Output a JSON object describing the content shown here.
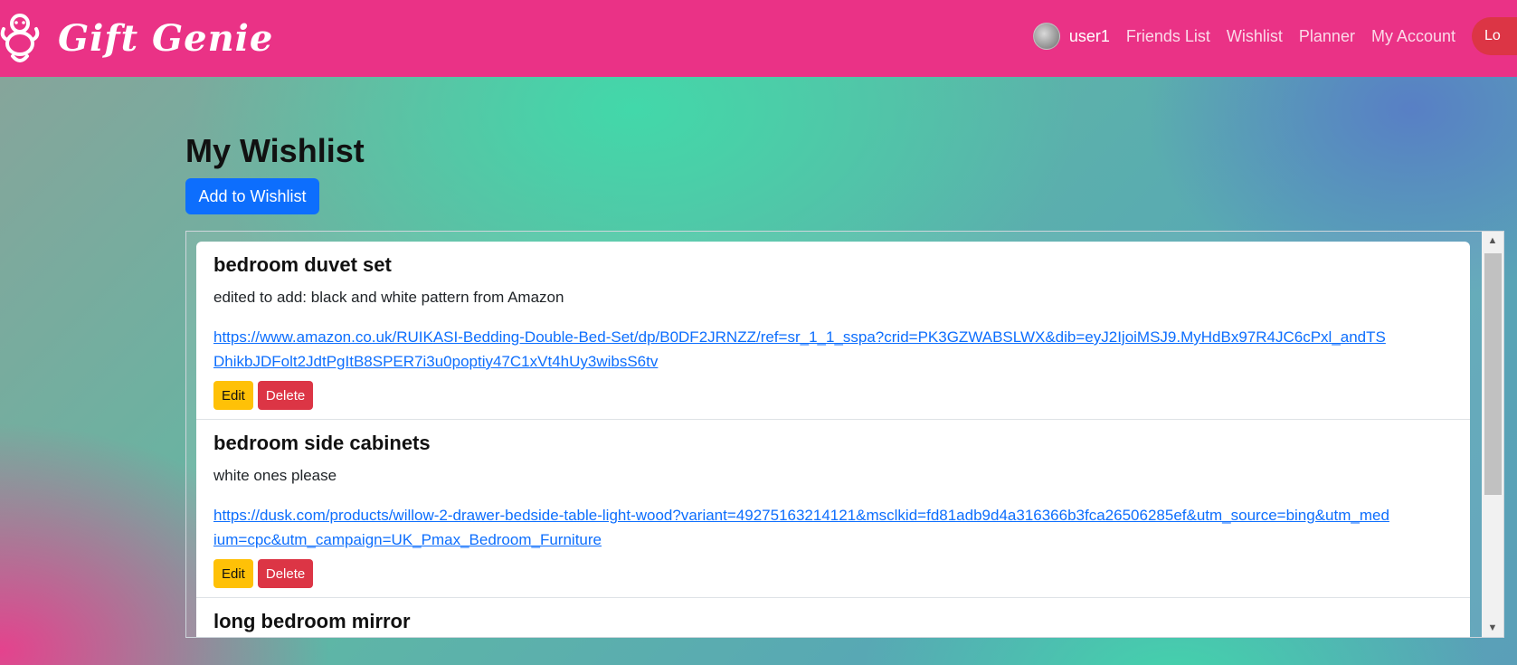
{
  "brand": {
    "name": "Gift Genie",
    "logo_icon": "genie-logo-icon"
  },
  "nav": {
    "username": "user1",
    "links": [
      "Friends List",
      "Wishlist",
      "Planner",
      "My Account"
    ],
    "logout_label": "Lo"
  },
  "main": {
    "title": "My Wishlist",
    "add_button": "Add to Wishlist"
  },
  "items": [
    {
      "title": "bedroom duvet set",
      "description": "edited to add: black and white pattern from Amazon",
      "link": "https://www.amazon.co.uk/RUIKASI-Bedding-Double-Bed-Set/dp/B0DF2JRNZZ/ref=sr_1_1_sspa?crid=PK3GZWABSLWX&dib=eyJ2IjoiMSJ9.MyHdBx97R4JC6cPxl_andTSDhikbJDFolt2JdtPgItB8SPER7i3u0poptiy47C1xVt4hUy3wibsS6tv",
      "edit_label": "Edit",
      "delete_label": "Delete"
    },
    {
      "title": "bedroom side cabinets",
      "description": "white ones please",
      "link": "https://dusk.com/products/willow-2-drawer-bedside-table-light-wood?variant=49275163214121&msclkid=fd81adb9d4a316366b3fca26506285ef&utm_source=bing&utm_medium=cpc&utm_campaign=UK_Pmax_Bedroom_Furniture",
      "edit_label": "Edit",
      "delete_label": "Delete"
    },
    {
      "title": "long bedroom mirror"
    }
  ],
  "colors": {
    "navbar": "#ea3286",
    "primary": "#0d6efd",
    "warning": "#ffc107",
    "danger": "#dc3545"
  }
}
